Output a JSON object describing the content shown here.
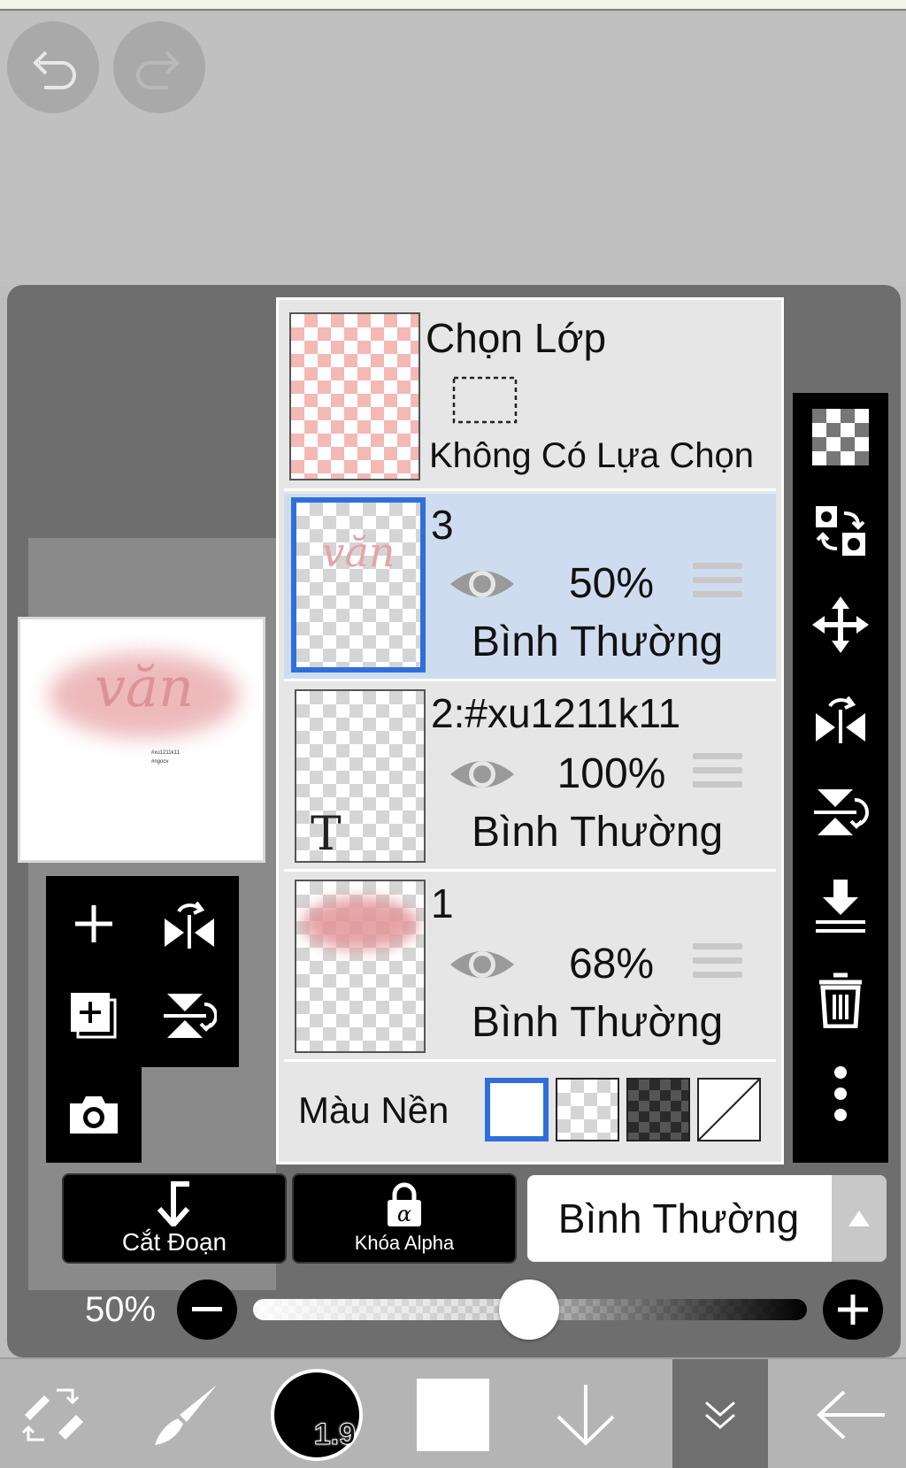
{
  "toolbar_top": {
    "undo_icon": "undo-icon",
    "redo_icon": "redo-icon"
  },
  "canvas_preview": {
    "logo_text": "văn",
    "small_text_1": "#xu1211k11",
    "small_text_2": "#ngocv"
  },
  "layer_panel": {
    "selection_layer": {
      "title": "Chọn Lớp",
      "status": "Không Có Lựa Chọn"
    },
    "layers": [
      {
        "name": "3",
        "opacity": "50%",
        "blend": "Bình Thường",
        "selected": true,
        "thumb_text": "văn",
        "type": "raster"
      },
      {
        "name": "2:#xu1211k11",
        "opacity": "100%",
        "blend": "Bình Thường",
        "selected": false,
        "thumb_text": "T",
        "type": "text"
      },
      {
        "name": "1",
        "opacity": "68%",
        "blend": "Bình Thường",
        "selected": false,
        "type": "raster"
      }
    ],
    "background": {
      "label": "Màu Nền",
      "options": [
        "white",
        "transparent",
        "dark-checker",
        "none"
      ],
      "selected": "white"
    }
  },
  "right_tools": [
    "transparency-icon",
    "swap-icon",
    "move-icon",
    "flip-horizontal-icon",
    "flip-vertical-icon",
    "merge-down-icon",
    "trash-icon",
    "more-icon"
  ],
  "left_tools": [
    "add-layer-icon",
    "flip-horizontal-icon",
    "add-copy-icon",
    "flip-vertical-icon",
    "camera-icon"
  ],
  "actions": {
    "clip_label": "Cắt Đoạn",
    "alpha_lock_label": "Khóa Alpha",
    "blend_mode": "Bình Thường"
  },
  "opacity_slider": {
    "label": "50%",
    "value": 0.5
  },
  "bottom_bar": {
    "brush_size": "1.9"
  },
  "colors": {
    "selected_layer": "#cfdcf0",
    "accent": "#2f6fdc",
    "pink": "#e7a2a5"
  }
}
